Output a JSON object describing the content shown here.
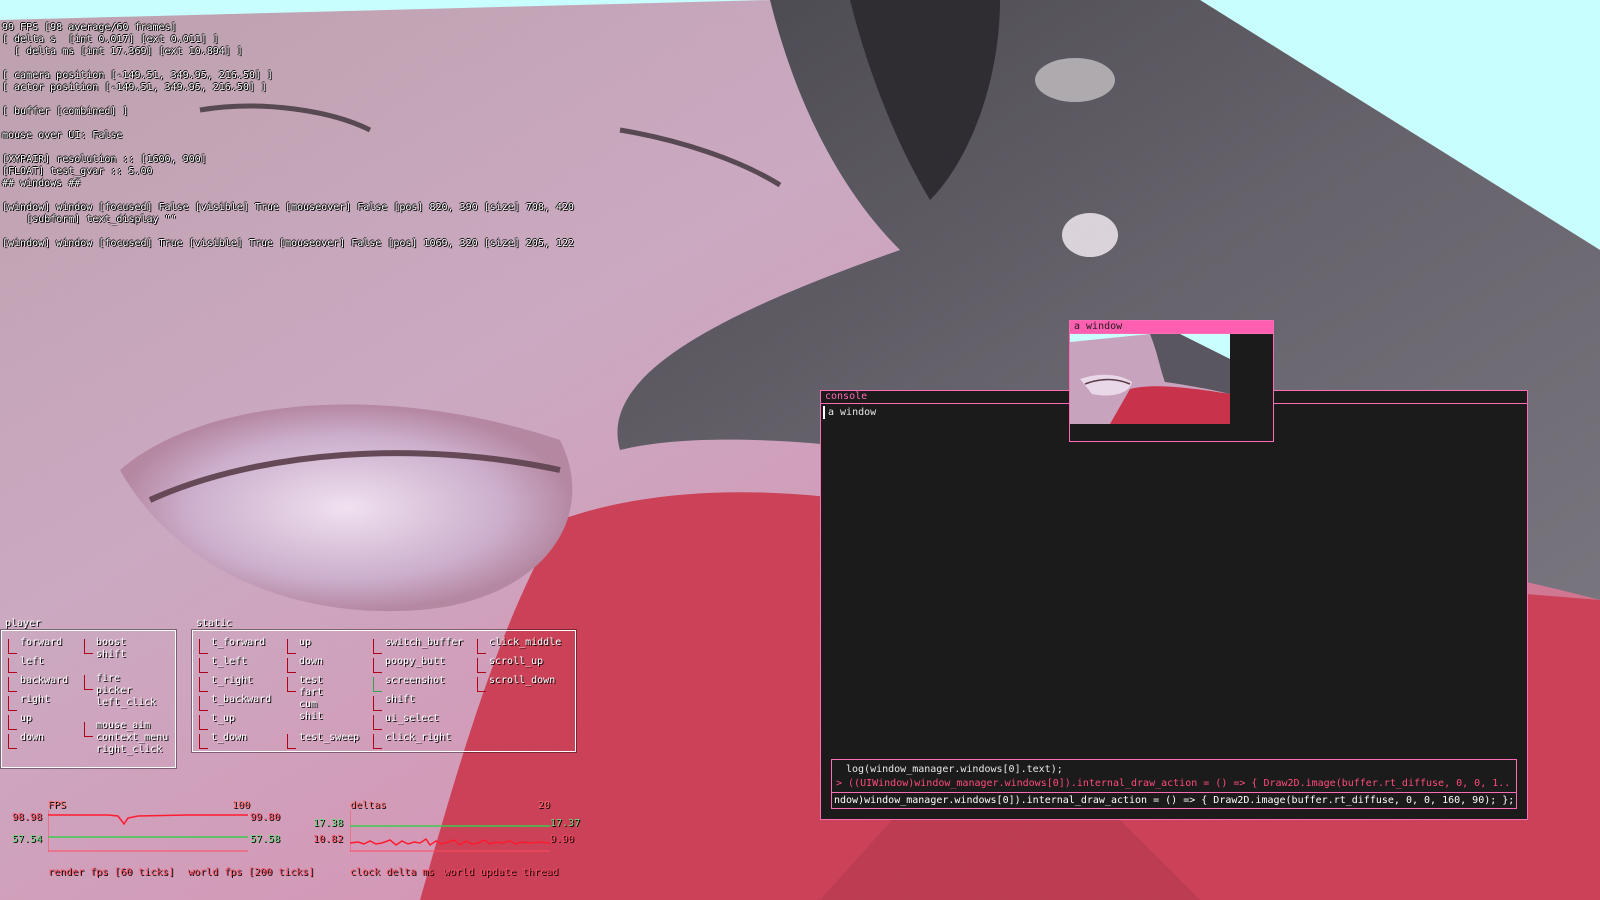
{
  "debug": {
    "lines": [
      "99 FPS [98 average/60 frames]",
      "[ delta s  [int 0.017] [ext 0.011] ]",
      "  [ delta ms [int 17.369] [ext 10.894] ]",
      "",
      "[ camera position [-149.51, 349.95, 216.50] ]",
      "[ actor position [-149.51, 349.95, 216.50] ]",
      "",
      "[ buffer [combined] ]",
      "",
      "mouse over UI: False",
      "",
      "[XYPAIR] resolution :: [1600, 900]",
      "[FLOAT] test_gvar :: 5.00",
      "## windows ##",
      "",
      "[window] window [focused] False [visible] True [mouseover] False [pos] 820, 390 [size] 708, 420",
      "    [subform] text_display \"\"",
      "",
      "[window] window [focused] True [visible] True [mouseover] False [pos] 1069, 320 [size] 205, 122"
    ]
  },
  "player_panel": {
    "title": "player",
    "col1": [
      "forward",
      "left",
      "backward",
      "right",
      "up",
      "down"
    ],
    "col2": [
      "boost\nshift",
      "fire\npicker\nleft_click",
      "mouse_aim\ncontext_menu\nright_click"
    ]
  },
  "static_panel": {
    "title": "static",
    "col1": [
      "t_forward",
      "t_left",
      "t_right",
      "t_backward",
      "t_up",
      "t_down"
    ],
    "col2": [
      "up",
      "down",
      "test\nfart\ncum\nshit",
      "test_sweep"
    ],
    "col3": [
      "switch_buffer",
      "poopy_butt",
      "screenshot",
      "shift",
      "ui_select",
      "click_right"
    ],
    "col4": [
      "click_middle",
      "scroll_up",
      "scroll_down"
    ]
  },
  "fps_graph": {
    "label": "FPS",
    "max_label": "100",
    "left_top": "98.98",
    "left_bottom": "57.54",
    "right_top": "99.80",
    "right_bottom": "57.58",
    "caption_render": "render fps [60 ticks]",
    "caption_world": "world fps [200 ticks]"
  },
  "delta_graph": {
    "label": "deltas",
    "max_label": "20",
    "left_top": "17.38",
    "left_bottom": "10.82",
    "right_top": "17.37",
    "right_bottom": "9.90",
    "caption_clock": "clock delta ms",
    "caption_world": "world update thread"
  },
  "console_window": {
    "title": "console",
    "text": "a window",
    "log_line": "log(window_manager.windows[0].text);",
    "error_line": "> ((UIWindow)window_manager.windows[0]).internal_draw_action = () => { Draw2D.image(buffer.rt_diffuse, 0, 0, 1...",
    "input_line": "ndow)window_manager.windows[0]).internal_draw_action = () => { Draw2D.image(buffer.rt_diffuse, 0, 0, 160, 90); };"
  },
  "image_window": {
    "title": "a window"
  },
  "colors": {
    "sky": "#c9ffff",
    "window_bg": "#1b1b1b",
    "window_border": "#ff6bb5",
    "key_off": "#b0001a",
    "key_on": "#2ea44f",
    "graph_red": "#ff4b5e",
    "graph_green": "#64e07a"
  }
}
